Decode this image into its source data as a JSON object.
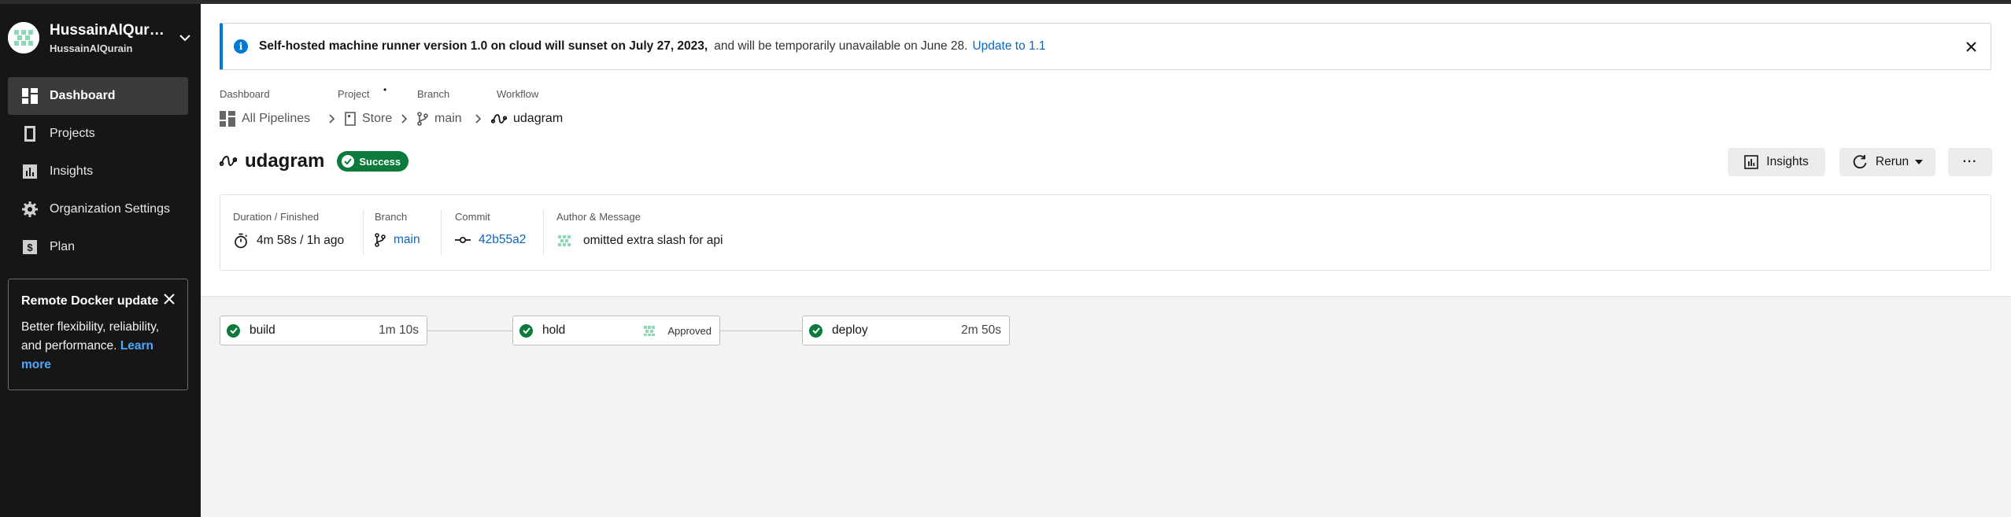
{
  "org": {
    "name": "HussainAlQur…",
    "username": "HussainAlQurain"
  },
  "sidebar": {
    "items": [
      {
        "label": "Dashboard",
        "icon": "dashboard-icon",
        "active": true
      },
      {
        "label": "Projects",
        "icon": "projects-icon",
        "active": false
      },
      {
        "label": "Insights",
        "icon": "insights-icon",
        "active": false
      },
      {
        "label": "Organization Settings",
        "icon": "gear-icon",
        "active": false
      },
      {
        "label": "Plan",
        "icon": "plan-icon",
        "active": false
      }
    ],
    "promo": {
      "title": "Remote Docker update",
      "body": "Better flexibility, reliability, and performance.",
      "link": "Learn more"
    }
  },
  "banner": {
    "bold": "Self-hosted machine runner version 1.0 on cloud will sunset on July 27, 2023,",
    "rest": "and will be temporarily unavailable on June 28.",
    "link": "Update to 1.1"
  },
  "breadcrumb": {
    "labels": {
      "dashboard": "Dashboard",
      "project": "Project",
      "project_marker": "•",
      "branch": "Branch",
      "workflow": "Workflow"
    },
    "items": {
      "dashboard": "All Pipelines",
      "project": "Store",
      "branch": "main",
      "workflow": "udagram"
    }
  },
  "workflow": {
    "name": "udagram",
    "status": "Success"
  },
  "actions": {
    "insights": "Insights",
    "rerun": "Rerun",
    "more": "···"
  },
  "summary": {
    "duration_label": "Duration / Finished",
    "duration_value": "4m 58s / 1h ago",
    "branch_label": "Branch",
    "branch_value": "main",
    "commit_label": "Commit",
    "commit_value": "42b55a2",
    "author_label": "Author & Message",
    "message": "omitted extra slash for api"
  },
  "jobs": [
    {
      "name": "build",
      "duration": "1m 10s"
    },
    {
      "name": "hold",
      "status": "Approved"
    },
    {
      "name": "deploy",
      "duration": "2m 50s"
    }
  ],
  "colors": {
    "sidebar_bg": "#161616",
    "accent_blue": "#0078d4",
    "link_blue": "#0a66c2",
    "success_green": "#0b7a3b"
  }
}
